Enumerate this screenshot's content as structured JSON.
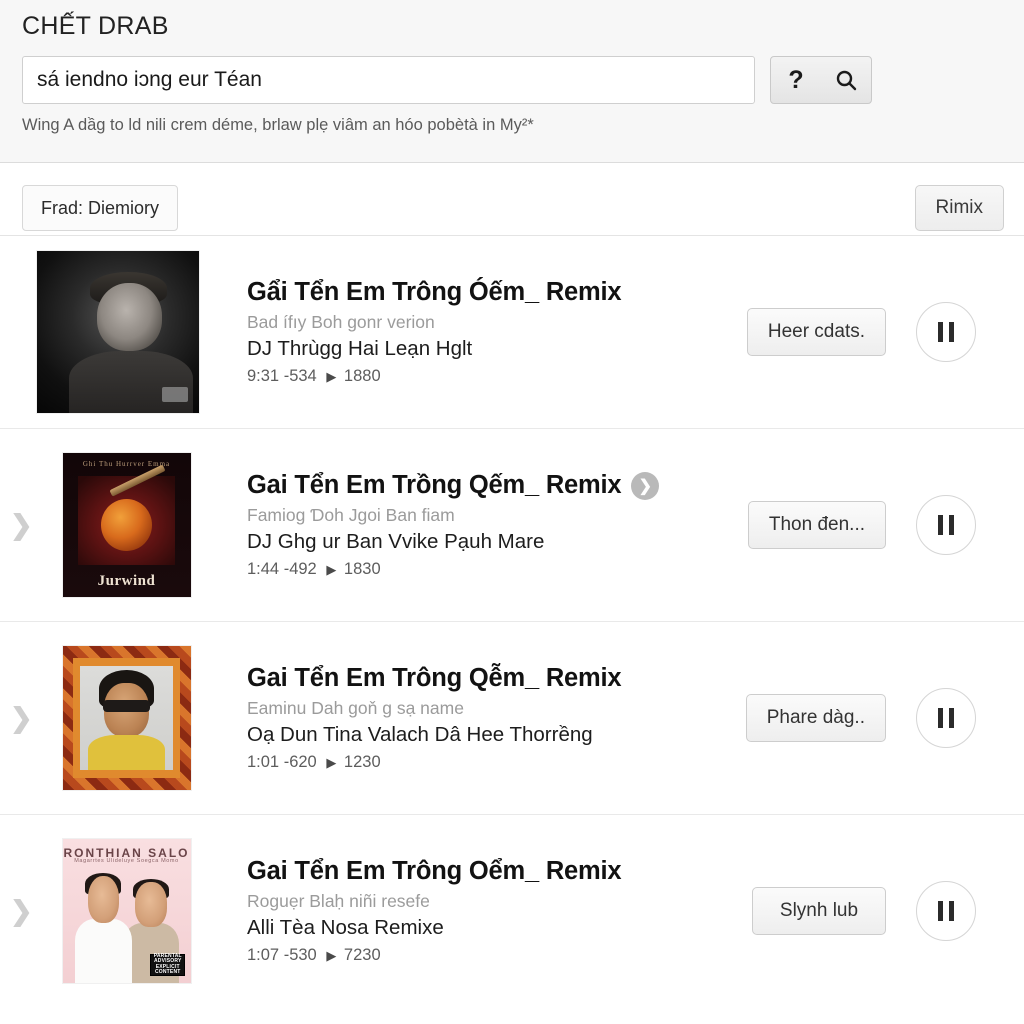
{
  "header": {
    "app_title": "CHẾT DRAB",
    "search": {
      "value": "sá iendno iɔng eur Téan",
      "placeholder": "sá iendno iɔng eur Téan",
      "help_icon": "question-mark-icon",
      "search_icon": "search-icon"
    },
    "caption": "Wing A dầg to ld nili crem déme, brlaw plẹ viâm an hóo pobètà in My²*"
  },
  "toolbar": {
    "tab_label": "Frad: Diemiory",
    "remix_label": "Rimix"
  },
  "tracks": [
    {
      "title": "Gẩi Tển Em Trông Óếm_ Remix",
      "subtitle": "Bad ífıy Boh gonr verion",
      "artist": "DJ Thrùgg Hai Leạn Hglt",
      "stats": "9:31 -534",
      "plays": "1880",
      "action_label": "Heer cdats.",
      "has_badge": false,
      "has_chevron": false,
      "thumb": "portrait-bw-dark"
    },
    {
      "title": "Gai Tển Em Trồng Qếm_ Remix",
      "subtitle": "Famiog Ɗoh Jgoi Ban fiam",
      "artist": "DJ Ghg ur Ban Vvike Pạuh Mare",
      "stats": "1:44 -492",
      "plays": "1830",
      "action_label": "Thon đen...",
      "has_badge": true,
      "has_chevron": true,
      "thumb": "album-maroon-instrument",
      "thumb_top_text": "Ghi Thu Hurrver Emma",
      "thumb_bottom_text": "Jurwind"
    },
    {
      "title": "Gai Tển Em Trông Qễm_ Remix",
      "subtitle": "Eaminu Dah goň g sạ name",
      "artist": "Oạ Dun Tina Valach Dâ Hee Thorrềng",
      "stats": "1:01 -620",
      "plays": "1230",
      "action_label": "Phare dàg..",
      "has_badge": false,
      "has_chevron": true,
      "thumb": "album-ornate-frame-portrait"
    },
    {
      "title": "Gai Tển Em Trông Oểm_ Remix",
      "subtitle": "Roguẹr Blaḥ niñi resefe",
      "artist": "Alli Tèa Nosa Remixe",
      "stats": "1:07 -530",
      "plays": "7230",
      "action_label": "Slynh lub",
      "has_badge": false,
      "has_chevron": true,
      "thumb": "album-pink-duo",
      "thumb_title": "RONTHIAN SALO",
      "thumb_subtitle": "Magarrtes Ulideluye Soegca Momo",
      "thumb_advisory": "PARENTAL ADVISORY EXPLICIT CONTENT"
    }
  ],
  "icons": {
    "play_glyph": "▶",
    "chevron_right": "❯",
    "badge_chevron": "❯"
  },
  "colors": {
    "page_bg": "#ffffff",
    "header_bg": "#f7f7f7",
    "border": "#dcdcdc",
    "title_text": "#121212",
    "muted_text": "#9b9b9b",
    "badge_gray": "#b9b9b9"
  }
}
